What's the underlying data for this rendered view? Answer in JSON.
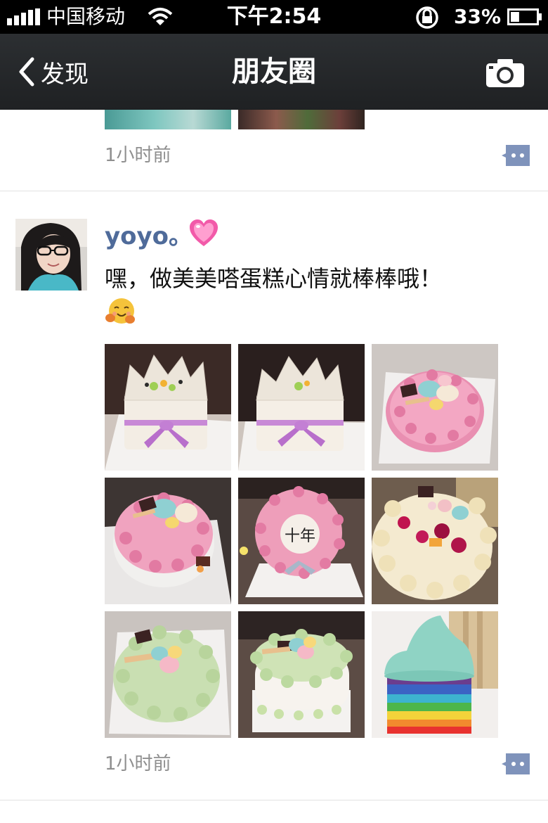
{
  "status_bar": {
    "carrier": "中国移动",
    "time": "下午2:54",
    "battery_percent": "33%",
    "battery_level": 0.33
  },
  "nav": {
    "back_label": "发现",
    "title": "朋友圈"
  },
  "previous_post": {
    "time": "1小时前"
  },
  "post": {
    "username": "yoyo。",
    "text": "嘿，做美美嗒蛋糕心情就棒棒哦！",
    "time": "1小时前",
    "photos": [
      {
        "name": "cake-photo-1",
        "cake_text": ""
      },
      {
        "name": "cake-photo-2",
        "cake_text": ""
      },
      {
        "name": "cake-photo-3",
        "cake_text": ""
      },
      {
        "name": "cake-photo-4",
        "cake_text": ""
      },
      {
        "name": "cake-photo-5",
        "cake_text": "十年"
      },
      {
        "name": "cake-photo-6",
        "cake_text": ""
      },
      {
        "name": "cake-photo-7",
        "cake_text": ""
      },
      {
        "name": "cake-photo-8",
        "cake_text": ""
      },
      {
        "name": "cake-photo-9",
        "cake_text": ""
      }
    ]
  },
  "icons": {
    "signal": "signal-icon",
    "wifi": "wifi-icon",
    "lock": "rotation-lock-icon",
    "battery": "battery-icon",
    "back": "chevron-left-icon",
    "camera": "camera-icon",
    "comment": "comment-icon",
    "heart": "heart-icon",
    "emoji": "hugging-face-icon"
  },
  "colors": {
    "username": "#4f6b9a",
    "nav_bg": "#262829",
    "time_text": "#8f8f8f",
    "comment_btn": "#7f93bb"
  }
}
